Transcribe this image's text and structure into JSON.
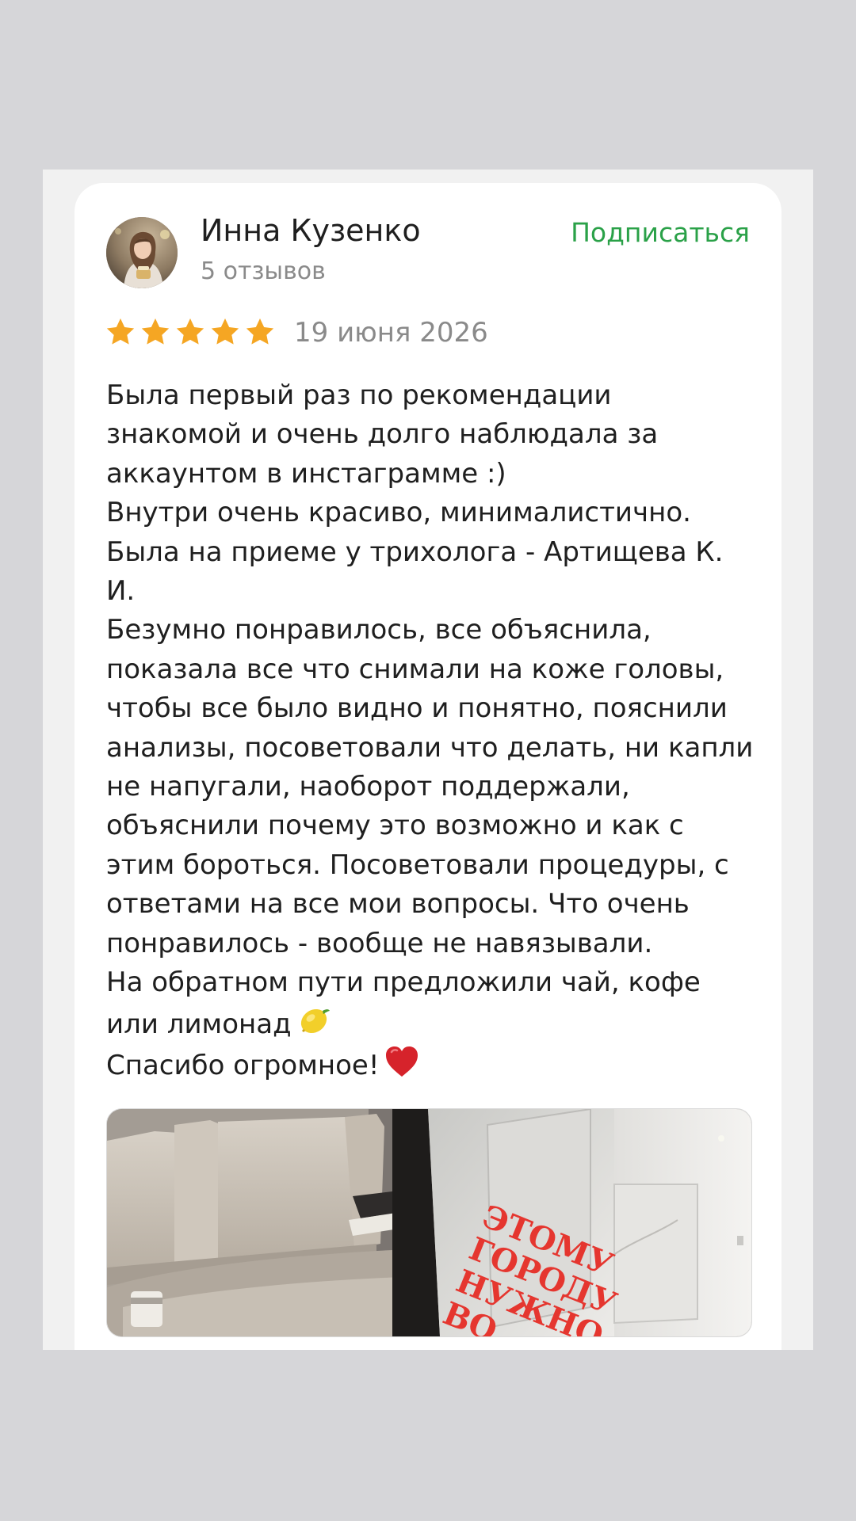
{
  "review": {
    "author": {
      "name": "Инна Кузенко",
      "reviews_count": "5 отзывов",
      "avatar": "avatar-photo"
    },
    "subscribe_label": "Подписаться",
    "rating": 5,
    "rating_max": 5,
    "date": "19 июня 2026",
    "text_lines": [
      "Была первый раз по рекомендации",
      "знакомой и очень долго наблюдала за",
      "аккаунтом в инстаграмме :)",
      "Внутри очень красиво, минималистично.",
      "Была на приеме у трихолога - Артищева К.",
      "И.",
      "Безумно понравилось, все объяснила,",
      "показала все что снимали на коже головы,",
      "чтобы все было видно и понятно, пояснили",
      "анализы, посоветовали что делать, ни капли",
      "не напугали, наоборот поддержали,",
      "объяснили почему это возможно и как с",
      "этим бороться. Посоветовали процедуры, с",
      "ответами на все мои вопросы. Что очень",
      "понравилось - вообще не навязывали.",
      "На обратном пути предложили чай, кофе",
      "или лимонад",
      "Спасибо огромное!"
    ],
    "emojis": {
      "lemonade": "lemon-emoji",
      "thanks": "red-heart-emoji"
    },
    "photo": {
      "sign_lines": [
        "ЭТОМУ",
        "ГОРОДУ",
        "НУЖНО",
        "ВО"
      ]
    }
  },
  "colors": {
    "page_background": "#d6d6d9",
    "panel_background": "#f1f1f1",
    "card_background": "#ffffff",
    "accent_green": "#2aa148",
    "star_gold": "#f5a623",
    "text_primary": "#1f1f1f",
    "text_secondary": "#8a8a8a",
    "sign_red": "#e5362f"
  }
}
